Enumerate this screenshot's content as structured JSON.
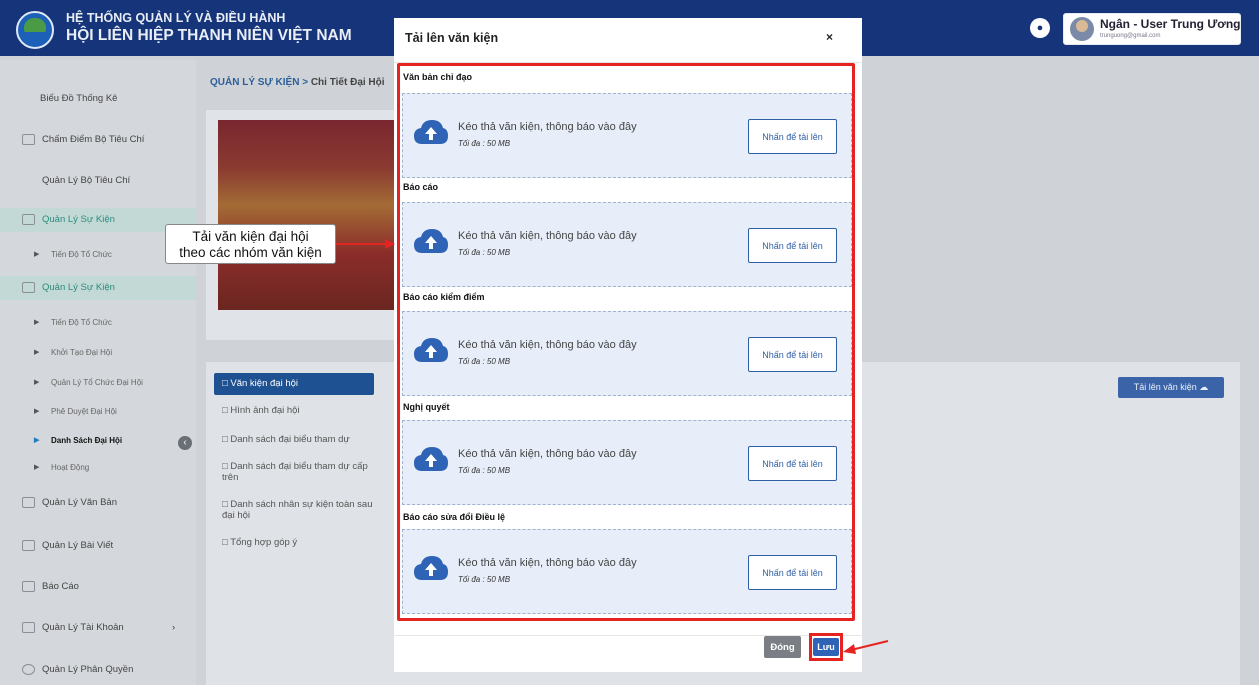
{
  "header": {
    "title_line1": "HỆ THỐNG QUẢN LÝ VÀ ĐIỀU HÀNH",
    "title_line2": "HỘI LIÊN HIỆP THANH NIÊN VIỆT NAM",
    "user_name": "Ngân - User Trung Ương",
    "user_email": "trunguong@gmail.com"
  },
  "sidebar": {
    "items": [
      "Biểu Đồ Thống Kê",
      "Chấm Điểm Bộ Tiêu Chí",
      "Quản Lý Bộ Tiêu Chí",
      "Quản Lý Sự Kiện",
      "Quản Lý Sự Kiện",
      "Quản Lý Văn Bản",
      "Quản Lý Bài Viết",
      "Báo Cáo",
      "Quản Lý Tài Khoản",
      "Quản Lý Phân Quyền"
    ],
    "sub1": [
      "Tiến Độ Tổ Chức"
    ],
    "sub2": [
      "Tiến Độ Tổ Chức",
      "Khởi Tạo Đại Hội",
      "Quản Lý Tổ Chức Đại Hội",
      "Phê Duyệt Đại Hội",
      "Danh Sách Đại Hội",
      "Hoạt Động"
    ]
  },
  "breadcrumb": {
    "root": "QUẢN LÝ SỰ KIỆN",
    "sep": ">",
    "current": "Chi Tiết Đại Hội"
  },
  "folders": [
    "Văn kiện đại hội",
    "Hình ảnh đại hội",
    "Danh sách đại biểu tham dự",
    "Danh sách đại biểu tham dự cấp trên",
    "Danh sách nhân sự kiện toàn sau đại hội",
    "Tổng hợp góp ý"
  ],
  "upload_button": "Tải lên văn kiện",
  "callout": {
    "line1": "Tải văn kiện đại hội",
    "line2": "theo các nhóm văn kiện"
  },
  "modal": {
    "title": "Tải lên văn kiện",
    "close_icon": "×",
    "groups": [
      "Văn bản chỉ đạo",
      "Báo cáo",
      "Báo cáo kiểm điểm",
      "Nghị quyết",
      "Báo cáo sửa đổi Điều lệ"
    ],
    "drop_text": "Kéo thả văn kiện, thông báo vào đây",
    "max_text": "Tối đa : 50 MB",
    "drop_button": "Nhấn để tải lên",
    "close_button": "Đóng",
    "save_button": "Lưu"
  },
  "colors": {
    "accent": "#e52421",
    "brand": "#15347a",
    "button": "#2f63b5"
  }
}
